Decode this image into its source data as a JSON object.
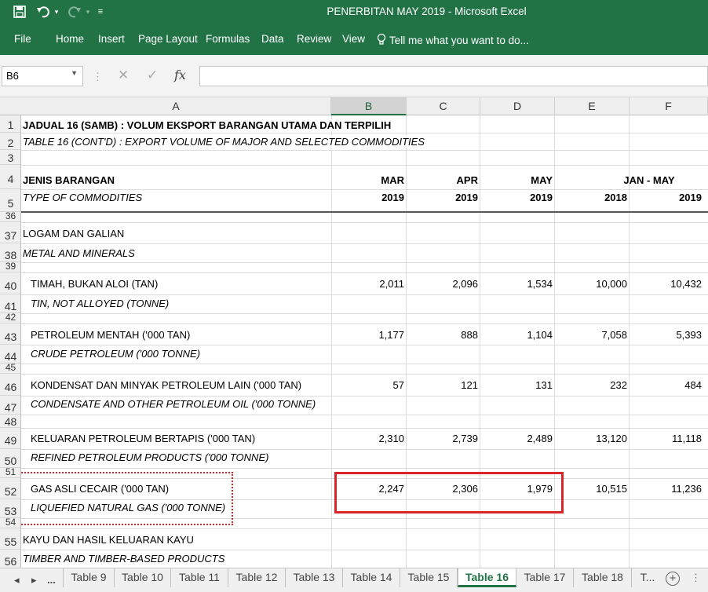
{
  "window": {
    "title": "PENERBITAN MAY 2019 - Microsoft Excel"
  },
  "quick_access": {
    "save": "save-icon",
    "undo": "undo-icon",
    "redo": "redo-icon",
    "customize": "customize-icon"
  },
  "ribbon": {
    "tabs": [
      "File",
      "Home",
      "Insert",
      "Page Layout",
      "Formulas",
      "Data",
      "Review",
      "View"
    ],
    "tell_me": "Tell me what you want to do..."
  },
  "formula_bar": {
    "name_box": "B6",
    "cancel": "✕",
    "enter": "✓",
    "fx": "fx",
    "content": ""
  },
  "columns": [
    "A",
    "B",
    "C",
    "D",
    "E",
    "F"
  ],
  "rows": [
    "1",
    "2",
    "3",
    "4",
    "5",
    "36",
    "37",
    "38",
    "39",
    "40",
    "41",
    "42",
    "43",
    "44",
    "45",
    "46",
    "47",
    "48",
    "49",
    "50",
    "51",
    "52",
    "53",
    "54",
    "55",
    "56"
  ],
  "sheet": {
    "title_ms": "JADUAL 16 (SAMB) : VOLUM EKSPORT BARANGAN UTAMA DAN TERPILIH",
    "title_en": "TABLE 16 (CONT'D) : EXPORT VOLUME OF MAJOR AND SELECTED COMMODITIES",
    "header_ms": "JENIS BARANGAN",
    "header_en": "TYPE OF COMMODITIES",
    "mar": "MAR",
    "apr": "APR",
    "may": "MAY",
    "jan_may": "JAN - MAY",
    "year_b": "2019",
    "year_c": "2019",
    "year_d": "2019",
    "year_e": "2018",
    "year_f": "2019",
    "group1_ms": "LOGAM DAN GALIAN",
    "group1_en": "METAL AND MINERALS",
    "group2_ms": "KAYU DAN HASIL KELUARAN KAYU",
    "group2_en": "TIMBER AND TIMBER-BASED PRODUCTS",
    "items": [
      {
        "ms": "TIMAH, BUKAN ALOI (TAN)",
        "en": "TIN, NOT ALLOYED (TONNE)",
        "values": [
          "2,011",
          "2,096",
          "1,534",
          "10,000",
          "10,432"
        ]
      },
      {
        "ms": "PETROLEUM MENTAH ('000 TAN)",
        "en": "CRUDE PETROLEUM ('000 TONNE)",
        "values": [
          "1,177",
          "888",
          "1,104",
          "7,058",
          "5,393"
        ]
      },
      {
        "ms": "KONDENSAT DAN MINYAK PETROLEUM LAIN ('000 TAN)",
        "en": "CONDENSATE AND OTHER PETROLEUM OIL ('000 TONNE)",
        "values": [
          "57",
          "121",
          "131",
          "232",
          "484"
        ]
      },
      {
        "ms": "KELUARAN PETROLEUM BERTAPIS ('000 TAN)",
        "en": "REFINED PETROLEUM PRODUCTS ('000 TONNE)",
        "values": [
          "2,310",
          "2,739",
          "2,489",
          "13,120",
          "11,118"
        ]
      },
      {
        "ms": "GAS ASLI CECAIR ('000 TAN)",
        "en": "LIQUEFIED NATURAL GAS ('000 TONNE)",
        "values": [
          "2,247",
          "2,306",
          "1,979",
          "10,515",
          "11,236"
        ]
      }
    ]
  },
  "sheet_tabs": {
    "ellipsis": "...",
    "tabs": [
      "Table 9",
      "Table 10",
      "Table 11",
      "Table 12",
      "Table 13",
      "Table 14",
      "Table 15",
      "Table 16",
      "Table 17",
      "Table 18",
      "T..."
    ],
    "active": "Table 16",
    "add": "+"
  },
  "colors": {
    "accent": "#217346",
    "annotation": "#d9242a"
  }
}
